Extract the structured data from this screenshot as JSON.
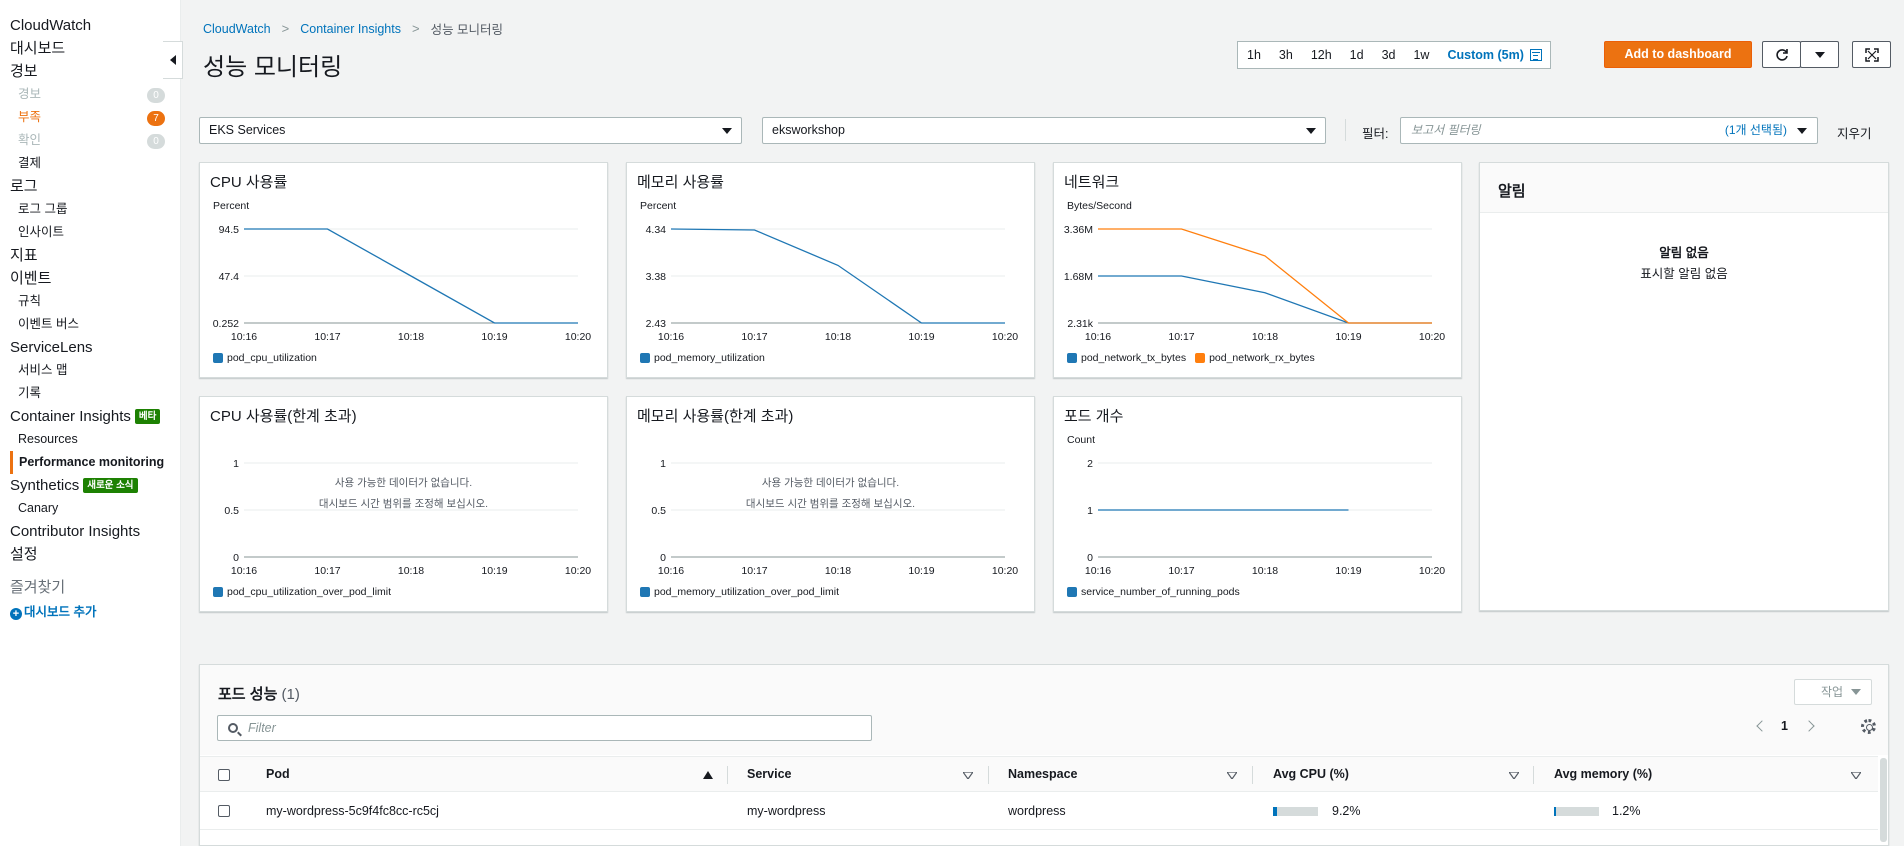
{
  "sidebar": {
    "items": [
      {
        "label": "CloudWatch",
        "level": "top"
      },
      {
        "label": "대시보드",
        "level": "top"
      },
      {
        "label": "경보",
        "level": "top"
      },
      {
        "label": "경보",
        "level": "sub",
        "state": "disabled",
        "count": "0"
      },
      {
        "label": "부족",
        "level": "sub",
        "state": "alarm",
        "count": "7"
      },
      {
        "label": "확인",
        "level": "sub",
        "state": "disabled",
        "count": "0"
      },
      {
        "label": "결제",
        "level": "sub"
      },
      {
        "label": "로그",
        "level": "top"
      },
      {
        "label": "로그 그룹",
        "level": "sub"
      },
      {
        "label": "인사이트",
        "level": "sub"
      },
      {
        "label": "지표",
        "level": "top"
      },
      {
        "label": "이벤트",
        "level": "top"
      },
      {
        "label": "규칙",
        "level": "sub"
      },
      {
        "label": "이벤트 버스",
        "level": "sub"
      },
      {
        "label": "ServiceLens",
        "level": "top"
      },
      {
        "label": "서비스 맵",
        "level": "sub"
      },
      {
        "label": "기록",
        "level": "sub"
      },
      {
        "label": "Container Insights",
        "level": "top",
        "badge": "베타"
      },
      {
        "label": "Resources",
        "level": "sub"
      },
      {
        "label": "Performance monitoring",
        "level": "sub",
        "state": "active"
      },
      {
        "label": "Synthetics",
        "level": "top",
        "badge": "새로운 소식"
      },
      {
        "label": "Canary",
        "level": "sub"
      },
      {
        "label": "Contributor Insights",
        "level": "top"
      },
      {
        "label": "설정",
        "level": "top"
      }
    ],
    "favorites_label": "즐겨찾기",
    "add_dashboard_label": "대시보드 추가"
  },
  "breadcrumb": [
    "CloudWatch",
    "Container Insights",
    "성능 모니터링"
  ],
  "page_title": "성능 모니터링",
  "time_range": {
    "options": [
      "1h",
      "3h",
      "12h",
      "1d",
      "3d",
      "1w"
    ],
    "custom": "Custom (5m)"
  },
  "add_to_dashboard_label": "Add to dashboard",
  "filters": {
    "resource_type": "EKS Services",
    "cluster": "eksworkshop",
    "filter_label": "필터:",
    "filter_placeholder": "보고서 필터링",
    "filter_selected": "(1개 선택됨)",
    "clear_label": "지우기"
  },
  "widgets": [
    {
      "title": "CPU 사용률",
      "unit": "Percent",
      "legend": [
        "pod_cpu_utilization"
      ]
    },
    {
      "title": "메모리 사용률",
      "unit": "Percent",
      "legend": [
        "pod_memory_utilization"
      ]
    },
    {
      "title": "네트워크",
      "unit": "Bytes/Second",
      "legend": [
        "pod_network_tx_bytes",
        "pod_network_rx_bytes"
      ]
    },
    {
      "title": "CPU 사용률(한계 초과)",
      "unit": "",
      "legend": [
        "pod_cpu_utilization_over_pod_limit"
      ],
      "no_data": [
        "사용 가능한 데이터가 없습니다.",
        "대시보드 시간 범위를 조정해 보십시오."
      ]
    },
    {
      "title": "메모리 사용률(한계 초과)",
      "unit": "",
      "legend": [
        "pod_memory_utilization_over_pod_limit"
      ],
      "no_data": [
        "사용 가능한 데이터가 없습니다.",
        "대시보드 시간 범위를 조정해 보십시오."
      ]
    },
    {
      "title": "포드 개수",
      "unit": "Count",
      "legend": [
        "service_number_of_running_pods"
      ]
    }
  ],
  "chart_data": [
    {
      "type": "line",
      "x": [
        "10:16",
        "10:17",
        "10:18",
        "10:19",
        "10:20"
      ],
      "y_ticks": [
        "0.252",
        "47.4",
        "94.5"
      ],
      "ylim": [
        0.252,
        94.5
      ],
      "series": [
        {
          "name": "pod_cpu_utilization",
          "color": "#1f77b4",
          "points": [
            [
              0,
              94.5
            ],
            [
              1,
              94.5
            ],
            [
              2,
              47.4
            ],
            [
              3,
              0.252
            ],
            [
              4,
              0.252
            ]
          ]
        }
      ]
    },
    {
      "type": "line",
      "x": [
        "10:16",
        "10:17",
        "10:18",
        "10:19",
        "10:20"
      ],
      "y_ticks": [
        "2.43",
        "3.38",
        "4.34"
      ],
      "ylim": [
        2.43,
        4.34
      ],
      "series": [
        {
          "name": "pod_memory_utilization",
          "color": "#1f77b4",
          "points": [
            [
              0,
              4.34
            ],
            [
              1,
              4.32
            ],
            [
              2,
              3.6
            ],
            [
              3,
              2.43
            ],
            [
              4,
              2.43
            ]
          ]
        }
      ]
    },
    {
      "type": "line",
      "x": [
        "10:16",
        "10:17",
        "10:18",
        "10:19",
        "10:20"
      ],
      "y_ticks": [
        "2.31k",
        "1.68M",
        "3.36M"
      ],
      "ylim": [
        0.00231,
        3.36
      ],
      "series": [
        {
          "name": "pod_network_tx_bytes",
          "color": "#1f77b4",
          "points": [
            [
              0,
              1.68
            ],
            [
              1,
              1.68
            ],
            [
              2,
              1.08
            ],
            [
              3,
              0.00231
            ],
            [
              4,
              0.00231
            ]
          ]
        },
        {
          "name": "pod_network_rx_bytes",
          "color": "#ff7f0e",
          "points": [
            [
              0,
              3.36
            ],
            [
              1,
              3.36
            ],
            [
              2,
              2.4
            ],
            [
              3,
              0.00231
            ],
            [
              4,
              0.00231
            ]
          ]
        }
      ]
    },
    {
      "type": "line",
      "x": [
        "10:16",
        "10:17",
        "10:18",
        "10:19",
        "10:20"
      ],
      "y_ticks": [
        "0",
        "0.5",
        "1"
      ],
      "ylim": [
        0,
        1
      ],
      "series": [
        {
          "name": "pod_cpu_utilization_over_pod_limit",
          "color": "#1f77b4",
          "points": []
        }
      ]
    },
    {
      "type": "line",
      "x": [
        "10:16",
        "10:17",
        "10:18",
        "10:19",
        "10:20"
      ],
      "y_ticks": [
        "0",
        "0.5",
        "1"
      ],
      "ylim": [
        0,
        1
      ],
      "series": [
        {
          "name": "pod_memory_utilization_over_pod_limit",
          "color": "#1f77b4",
          "points": []
        }
      ]
    },
    {
      "type": "line",
      "x": [
        "10:16",
        "10:17",
        "10:18",
        "10:19",
        "10:20"
      ],
      "y_ticks": [
        "0",
        "1",
        "2"
      ],
      "ylim": [
        0,
        2
      ],
      "series": [
        {
          "name": "service_number_of_running_pods",
          "color": "#1f77b4",
          "points": [
            [
              0,
              1
            ],
            [
              1,
              1
            ],
            [
              2,
              1
            ],
            [
              3,
              1
            ]
          ]
        }
      ]
    }
  ],
  "alarms": {
    "title": "알림",
    "empty_title": "알림 없음",
    "empty_sub": "표시할 알림 없음"
  },
  "pods": {
    "title": "포드 성능",
    "count": "(1)",
    "action_label": "작업",
    "search_placeholder": "Filter",
    "page": "1",
    "columns": [
      "Pod",
      "Service",
      "Namespace",
      "Avg CPU (%)",
      "Avg memory (%)"
    ],
    "rows": [
      {
        "pod": "my-wordpress-5c9f4fc8cc-rc5cj",
        "service": "my-wordpress",
        "namespace": "wordpress",
        "cpu": "9.2%",
        "cpu_fraction": 0.092,
        "memory": "1.2%",
        "memory_fraction": 0.05
      }
    ]
  }
}
